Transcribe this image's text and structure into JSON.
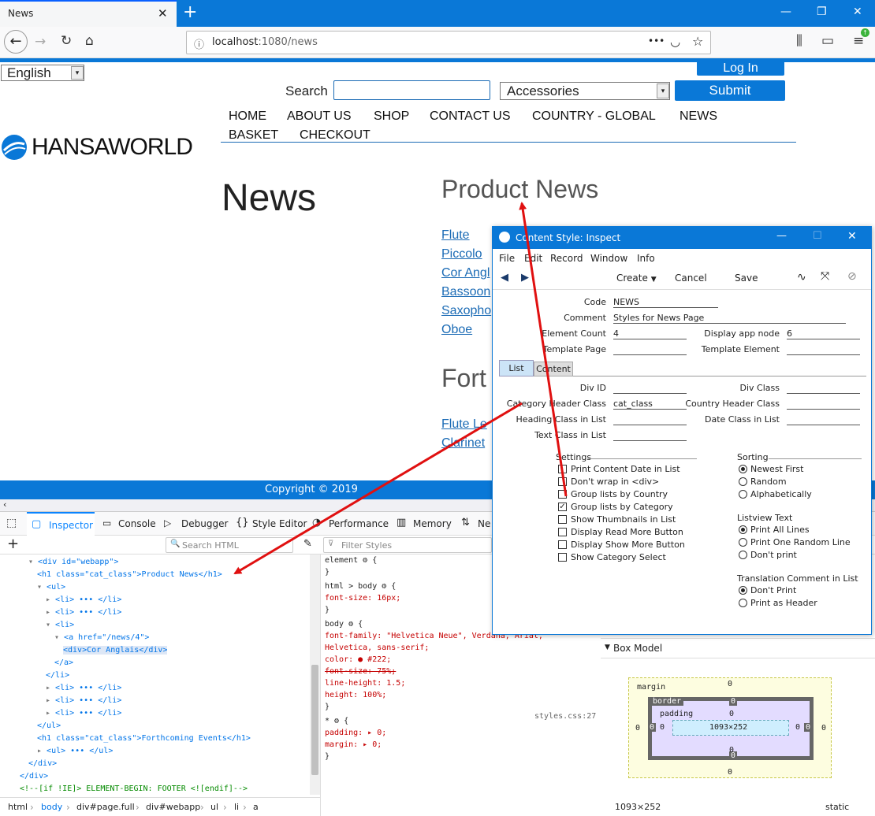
{
  "browser": {
    "tab_title": "News",
    "url_host": "localhost",
    "url_path": ":1080/news",
    "menu_dots": "•••"
  },
  "site": {
    "language": "English",
    "login": "Log In",
    "search_label": "Search",
    "category": "Accessories",
    "submit": "Submit",
    "nav": [
      "HOME",
      "ABOUT US",
      "SHOP",
      "CONTACT US",
      "COUNTRY - GLOBAL",
      "NEWS",
      "BASKET",
      "CHECKOUT"
    ],
    "logo": "HANSAWORLD",
    "page_title": "News",
    "section1": "Product News",
    "products": [
      "Flute",
      "Piccolo",
      "Cor Angl",
      "Bassoon",
      "Saxopho",
      "Oboe"
    ],
    "section2": "Fort",
    "events": [
      "Flute Le",
      "Clarinet"
    ],
    "footer": "Copyright © 2019"
  },
  "app": {
    "title": "Content Style: Inspect",
    "menu": [
      "File",
      "Edit",
      "Record",
      "Window",
      "Info"
    ],
    "toolbar": {
      "create": "Create",
      "cancel": "Cancel",
      "save": "Save"
    },
    "fields": {
      "code_label": "Code",
      "code": "NEWS",
      "comment_label": "Comment",
      "comment": "Styles for News Page",
      "count_label": "Element Count",
      "count": "4",
      "node_label": "Display app node",
      "node": "6",
      "tpage_label": "Template Page",
      "telem_label": "Template Element"
    },
    "tabs": [
      "List",
      "Content"
    ],
    "list": {
      "divid": "Div ID",
      "divclass": "Div Class",
      "cathdr": "Category Header Class",
      "cathdr_val": "cat_class",
      "countryhdr": "Country Header Class",
      "heading": "Heading Class in List",
      "dateclass": "Date Class in List",
      "textclass": "Text Class in List"
    },
    "settings_title": "Settings",
    "settings": [
      {
        "label": "Print Content Date in List",
        "checked": false
      },
      {
        "label": "Don't wrap in <div>",
        "checked": false
      },
      {
        "label": "Group lists by Country",
        "checked": false
      },
      {
        "label": "Group lists by Category",
        "checked": true
      },
      {
        "label": "Show Thumbnails in List",
        "checked": false
      },
      {
        "label": "Display Read More Button",
        "checked": false
      },
      {
        "label": "Display Show More Button",
        "checked": false
      },
      {
        "label": "Show Category Select",
        "checked": false
      }
    ],
    "sorting_title": "Sorting",
    "sorting": [
      "Newest First",
      "Random",
      "Alphabetically"
    ],
    "listview_title": "Listview Text",
    "listview": [
      "Print All Lines",
      "Print One Random Line",
      "Don't print"
    ],
    "translation_title": "Translation Comment in List",
    "translation": [
      "Don't Print",
      "Print as Header"
    ]
  },
  "devtools": {
    "tabs": [
      "Inspector",
      "Console",
      "Debugger",
      "Style Editor",
      "Performance",
      "Memory",
      "Ne"
    ],
    "search_placeholder": "Search HTML",
    "filter_placeholder": "Filter Styles",
    "html": [
      {
        "indent": 0,
        "arrow": "▾",
        "text": "<div id=\"webapp\">"
      },
      {
        "indent": 1,
        "arrow": "",
        "text": "<h1 class=\"cat_class\">Product News</h1>"
      },
      {
        "indent": 1,
        "arrow": "▾",
        "text": "<ul>"
      },
      {
        "indent": 2,
        "arrow": "▸",
        "text": "<li> ••• </li>"
      },
      {
        "indent": 2,
        "arrow": "▸",
        "text": "<li> ••• </li>"
      },
      {
        "indent": 2,
        "arrow": "▾",
        "text": "<li>"
      },
      {
        "indent": 3,
        "arrow": "▾",
        "text": "<a href=\"/news/4\">"
      },
      {
        "indent": 4,
        "arrow": "",
        "text": "<div>Cor Anglais</div>"
      },
      {
        "indent": 3,
        "arrow": "",
        "text": "</a>"
      },
      {
        "indent": 2,
        "arrow": "",
        "text": "</li>"
      },
      {
        "indent": 2,
        "arrow": "▸",
        "text": "<li> ••• </li>"
      },
      {
        "indent": 2,
        "arrow": "▸",
        "text": "<li> ••• </li>"
      },
      {
        "indent": 2,
        "arrow": "▸",
        "text": "<li> ••• </li>"
      },
      {
        "indent": 1,
        "arrow": "",
        "text": "</ul>"
      },
      {
        "indent": 1,
        "arrow": "",
        "text": "<h1 class=\"cat_class\">Forthcoming Events</h1>"
      },
      {
        "indent": 1,
        "arrow": "▸",
        "text": "<ul> ••• </ul>"
      },
      {
        "indent": 0,
        "arrow": "",
        "text": "</div>"
      },
      {
        "indent": -1,
        "arrow": "",
        "text": "</div>"
      },
      {
        "indent": -1,
        "arrow": "",
        "text": "<!--[if !IE]> ELEMENT-BEGIN: FOOTER <![endif]-->"
      }
    ],
    "css": [
      "element ⚙ {",
      "}",
      "html > body ⚙ {",
      "  font-size: 16px;",
      "}",
      "body ⚙ {",
      "  font-family: \"Helvetica Neue\", Verdana, Arial,",
      "       Helvetica, sans-serif;",
      "  color: ● #222;",
      "  font-size: 75%;",
      "  line-height: 1.5;",
      "  height: 100%;",
      "}",
      "* ⚙ {",
      "  padding: ▸ 0;",
      "  margin: ▸ 0;",
      "}"
    ],
    "css_source": "styles.css:27",
    "box_model_title": "Box Model",
    "box": {
      "margin": "margin",
      "border": "border",
      "padding": "padding",
      "content": "1093×252",
      "zero": "0"
    },
    "box_size": "1093×252",
    "position": "static",
    "breadcrumbs": [
      "html",
      "body",
      "div#page.full",
      "div#webapp",
      "ul",
      "li",
      "a"
    ]
  }
}
